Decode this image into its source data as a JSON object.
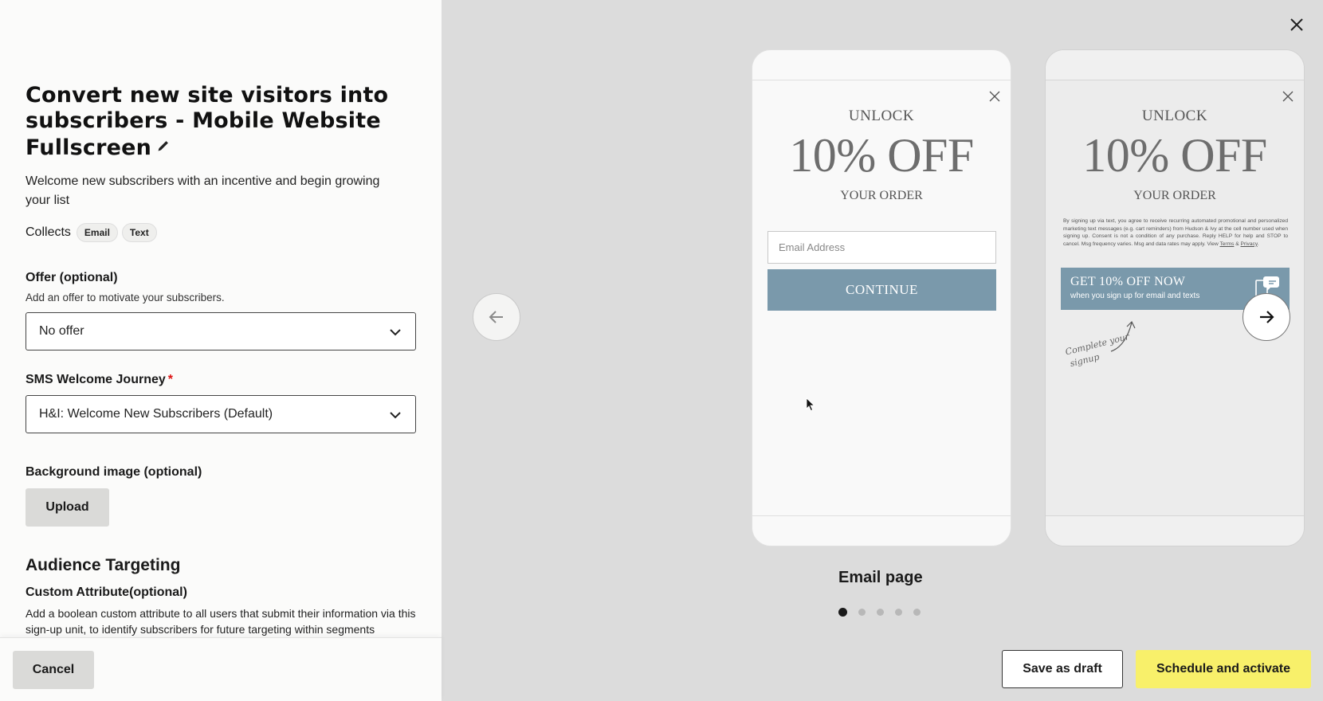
{
  "header": {
    "title": "Convert new site visitors into subscribers - Mobile Website Fullscreen",
    "description": "Welcome new subscribers with an incentive and begin growing your list",
    "collects_label": "Collects",
    "collects_chips": [
      "Email",
      "Text"
    ]
  },
  "offer": {
    "label": "Offer (optional)",
    "help": "Add an offer to motivate your subscribers.",
    "value": "No offer"
  },
  "journey": {
    "label": "SMS Welcome Journey",
    "required_mark": "*",
    "value": "H&I: Welcome New Subscribers (Default)"
  },
  "background": {
    "label": "Background image (optional)",
    "upload_label": "Upload"
  },
  "audience": {
    "heading": "Audience Targeting",
    "custom_label": "Custom Attribute(optional)",
    "custom_desc": "Add a boolean custom attribute to all users that submit their information via this sign-up unit, to identify subscribers for future targeting within segments"
  },
  "footer": {
    "cancel_label": "Cancel",
    "draft_label": "Save as draft",
    "activate_label": "Schedule and activate"
  },
  "preview": {
    "page_label": "Email page",
    "dot_count": 5,
    "active_dot": 0,
    "email_page": {
      "unlock": "UNLOCK",
      "offer": "10% OFF",
      "your_order": "YOUR ORDER",
      "email_placeholder": "Email Address",
      "continue_label": "CONTINUE"
    },
    "sms_page": {
      "unlock": "UNLOCK",
      "offer": "10% OFF",
      "your_order": "YOUR ORDER",
      "legal_text": "By signing up via text, you agree to receive recurring automated promotional and personalized marketing text messages (e.g. cart reminders) from Hudson & Ivy at the cell number used when signing up. Consent is not a condition of any purchase. Reply HELP for help and STOP to cancel. Msg frequency varies. Msg and data rates may apply. View",
      "legal_terms": "Terms",
      "legal_amp": "&",
      "legal_privacy": "Privacy",
      "cta_line1": "GET 10% OFF NOW",
      "cta_line2": "when you sign up for email and texts",
      "handwriting_line1": "Complete your",
      "handwriting_line2": "signup"
    }
  },
  "colors": {
    "accent_yellow": "#f8f06a",
    "cta_blue": "#7a99ab",
    "right_bg": "#dcdcdc"
  }
}
